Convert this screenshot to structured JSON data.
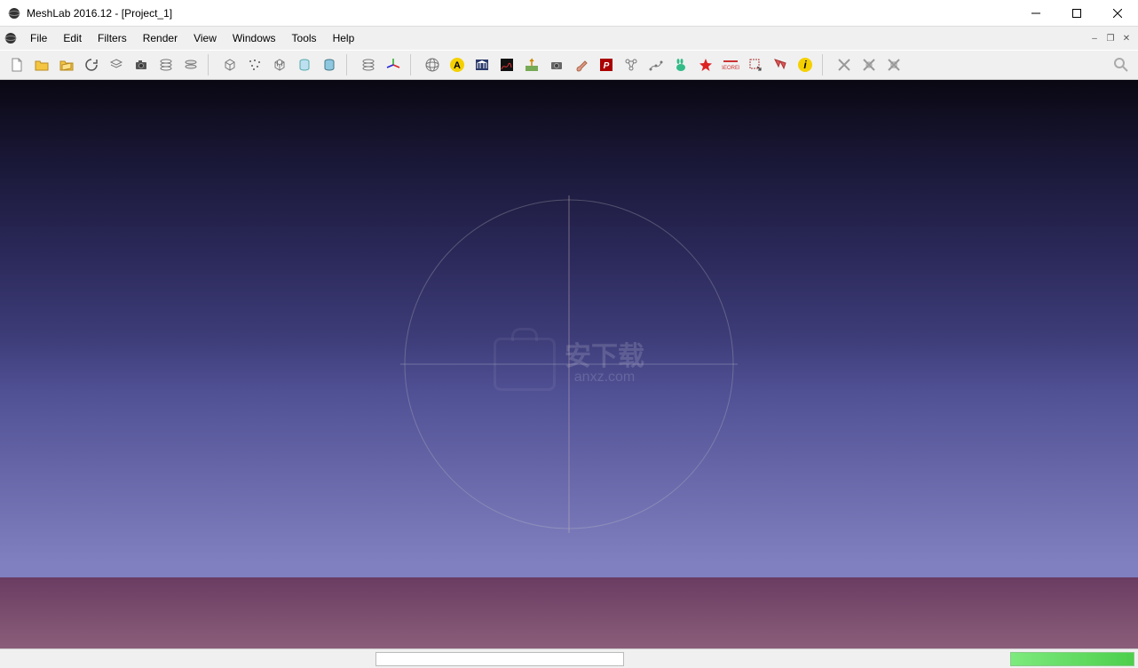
{
  "window": {
    "title": "MeshLab 2016.12 - [Project_1]"
  },
  "menu": {
    "items": [
      "File",
      "Edit",
      "Filters",
      "Render",
      "View",
      "Windows",
      "Tools",
      "Help"
    ]
  },
  "toolbar": {
    "groups": [
      [
        "new-document",
        "open-folder",
        "browse-folder",
        "reload",
        "tile",
        "camera",
        "layers-stack",
        "layers-merge"
      ],
      [
        "box-wireframe",
        "points-scatter",
        "box-grid",
        "cylinder-light",
        "cylinder-shade"
      ],
      [
        "layer-stack-2",
        "axes-colored"
      ],
      [
        "globe-wireframe",
        "annotate-yellow",
        "museum-blue",
        "plot-curve",
        "field-arrow",
        "camera-snap",
        "brush-paint",
        "pp-red",
        "graph-nodes",
        "spline-nodes",
        "rabbit-green",
        "star-red",
        "georef-text",
        "select-region",
        "select-triangles",
        "info-yellow"
      ],
      [
        "crossed-tools-a",
        "crossed-tools-b",
        "crossed-tools-c"
      ]
    ],
    "search": "search"
  },
  "watermark": {
    "line1": "安下载",
    "line2": "anxz.com"
  },
  "status": {
    "message": ""
  }
}
